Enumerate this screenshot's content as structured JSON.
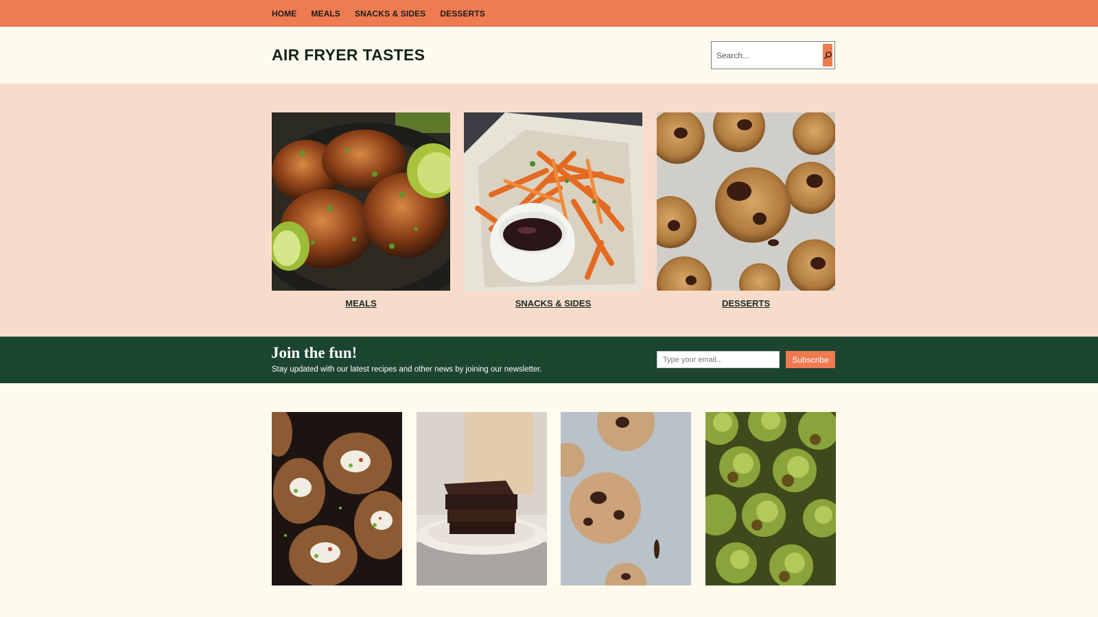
{
  "nav": {
    "items": [
      "HOME",
      "MEALS",
      "SNACKS & SIDES",
      "DESSERTS"
    ]
  },
  "header": {
    "site_title": "AIR FRYER TASTES",
    "search_placeholder": "Search...",
    "search_icon": "search-icon"
  },
  "categories": [
    {
      "label": "MEALS",
      "image": "grilled-chicken-thighs-with-lime"
    },
    {
      "label": "SNACKS & SIDES",
      "image": "sweet-potato-fries-with-dip"
    },
    {
      "label": "DESSERTS",
      "image": "chocolate-chip-cookies"
    }
  ],
  "newsletter": {
    "title": "Join the fun!",
    "text": "Stay updated with our latest recipes and other news by joining our newsletter.",
    "email_placeholder": "Type your email...",
    "button_label": "Subscribe"
  },
  "posts": [
    {
      "image": "loaded-baked-potatoes"
    },
    {
      "image": "brownie-stack-on-plate"
    },
    {
      "image": "chocolate-chunk-cookies"
    },
    {
      "image": "roasted-brussels-sprouts"
    }
  ],
  "colors": {
    "accent": "#ef7b51",
    "cream": "#fffaee",
    "peach": "#f8dccb",
    "forest": "#1c4530"
  }
}
